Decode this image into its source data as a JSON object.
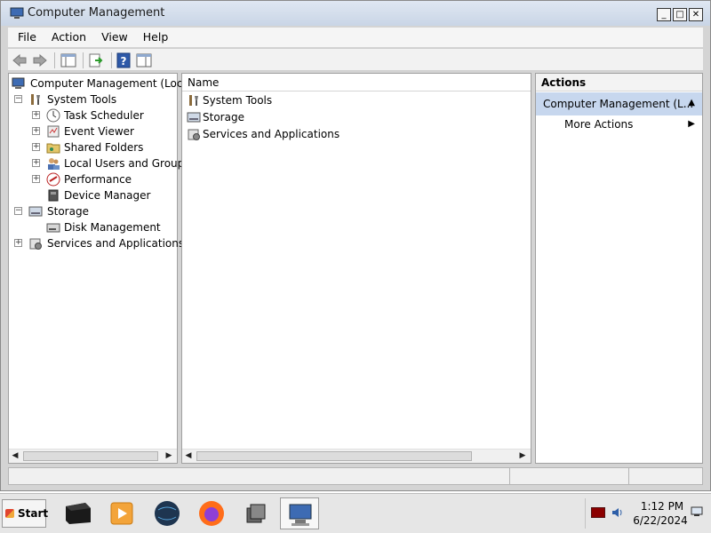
{
  "window": {
    "title": "Computer Management",
    "buttons": [
      "_",
      "□",
      "✕"
    ]
  },
  "menu": [
    "File",
    "Action",
    "View",
    "Help"
  ],
  "toolbar": {
    "icons": [
      "back-arrow-icon",
      "forward-arrow-icon",
      "show-hide-console-tree-icon",
      "export-list-icon",
      "help-icon",
      "show-hide-action-pane-icon"
    ]
  },
  "tree": {
    "root": "Computer Management (Local",
    "items": [
      {
        "label": "System Tools",
        "icon": "system-tools-icon",
        "expander": "⊟"
      },
      {
        "label": "Task Scheduler",
        "icon": "task-scheduler-icon",
        "expander": "⊞"
      },
      {
        "label": "Event Viewer",
        "icon": "event-viewer-icon",
        "expander": "⊞"
      },
      {
        "label": "Shared Folders",
        "icon": "shared-folders-icon",
        "expander": "⊞"
      },
      {
        "label": "Local Users and Groups",
        "icon": "local-users-icon",
        "expander": "⊞"
      },
      {
        "label": "Performance",
        "icon": "performance-icon",
        "expander": "⊞"
      },
      {
        "label": "Device Manager",
        "icon": "device-manager-icon",
        "expander": ""
      },
      {
        "label": "Storage",
        "icon": "storage-icon",
        "expander": "⊟"
      },
      {
        "label": "Disk Management",
        "icon": "disk-management-icon",
        "expander": ""
      },
      {
        "label": "Services and Applications",
        "icon": "services-applications-icon",
        "expander": "⊞"
      }
    ]
  },
  "list": {
    "column": "Name",
    "items": [
      "System Tools",
      "Storage",
      "Services and Applications"
    ]
  },
  "actions": {
    "header": "Actions",
    "section": "Computer Management (L...",
    "section_arrow": "▲",
    "item": "More Actions",
    "item_arrow": "▶"
  },
  "scroll": {
    "left": "◀",
    "right": "▶"
  },
  "taskbar": {
    "start": "Start",
    "time": "1:12 PM",
    "date": "6/22/2024"
  },
  "colors": {
    "selection": "#c7d7ee",
    "title_gradient_top": "#dfe7f2"
  }
}
